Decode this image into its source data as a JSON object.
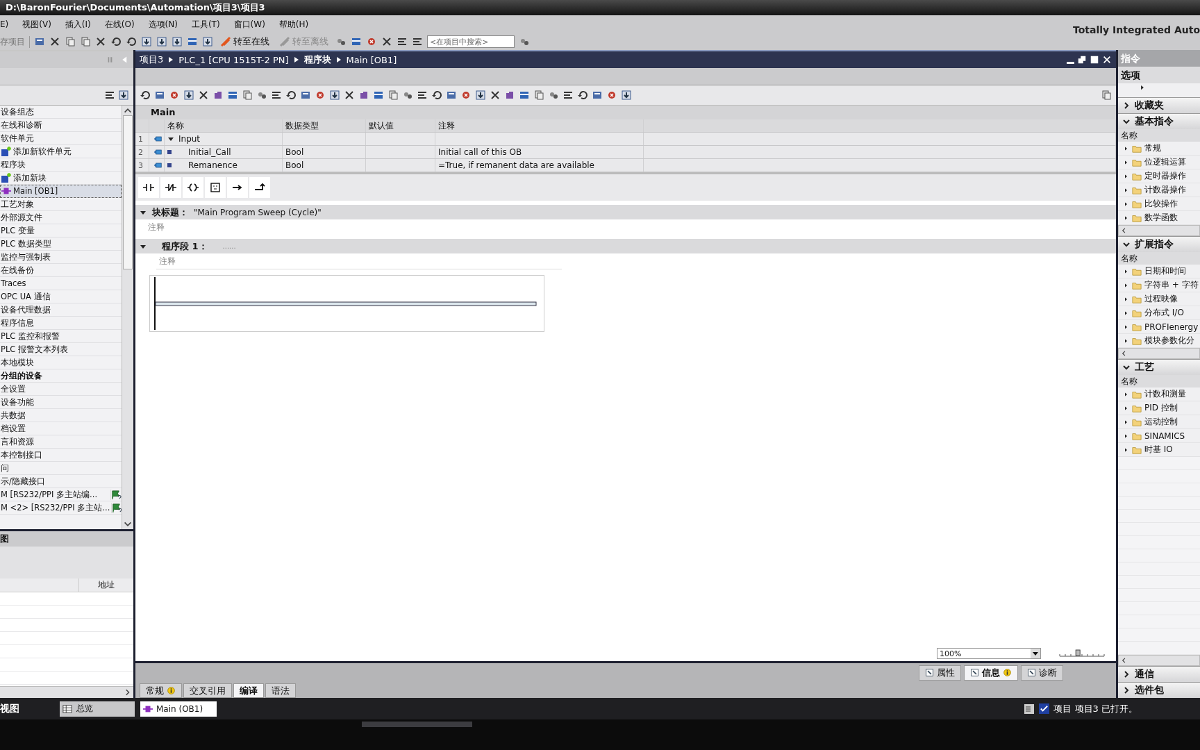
{
  "window": {
    "title": "D:\\BaronFourier\\Documents\\Automation\\项目3\\项目3"
  },
  "menu": [
    "E)",
    "视图(V)",
    "插入(I)",
    "在线(O)",
    "选项(N)",
    "工具(T)",
    "窗口(W)",
    "帮助(H)"
  ],
  "toolbar": {
    "save_label": "存项目",
    "online": {
      "label": "转至在线",
      "disabled": false
    },
    "offline": {
      "label": "转至离线",
      "disabled": true
    },
    "search": {
      "placeholder": "<在项目中搜索>"
    }
  },
  "brand": "Totally Integrated Auto",
  "project_tree": {
    "items": [
      {
        "label": "设备组态",
        "kind": "item",
        "selected": false
      },
      {
        "label": "在线和诊断",
        "kind": "item",
        "selected": false
      },
      {
        "label": "软件单元",
        "kind": "item",
        "selected": false
      },
      {
        "label": "添加新软件单元",
        "kind": "add",
        "selected": false
      },
      {
        "label": "程序块",
        "kind": "item",
        "selected": false
      },
      {
        "label": "添加新块",
        "kind": "add",
        "selected": false
      },
      {
        "label": "Main [OB1]",
        "kind": "block",
        "selected": true
      },
      {
        "label": "工艺对象",
        "kind": "item",
        "selected": false
      },
      {
        "label": "外部源文件",
        "kind": "item",
        "selected": false
      },
      {
        "label": "PLC 变量",
        "kind": "item",
        "selected": false
      },
      {
        "label": "PLC 数据类型",
        "kind": "item",
        "selected": false
      },
      {
        "label": "监控与强制表",
        "kind": "item",
        "selected": false
      },
      {
        "label": "在线备份",
        "kind": "item",
        "selected": false
      },
      {
        "label": "Traces",
        "kind": "item",
        "selected": false
      },
      {
        "label": "OPC UA 通信",
        "kind": "item",
        "selected": false
      },
      {
        "label": "设备代理数据",
        "kind": "item",
        "selected": false
      },
      {
        "label": "程序信息",
        "kind": "item",
        "selected": false
      },
      {
        "label": "PLC 监控和报警",
        "kind": "item",
        "selected": false
      },
      {
        "label": "PLC 报警文本列表",
        "kind": "item",
        "selected": false
      },
      {
        "label": "本地模块",
        "kind": "item",
        "selected": false
      },
      {
        "label": "分组的设备",
        "kind": "group",
        "selected": false
      },
      {
        "label": "全设置",
        "kind": "item",
        "selected": false
      },
      {
        "label": "设备功能",
        "kind": "item",
        "selected": false
      },
      {
        "label": "共数据",
        "kind": "item",
        "selected": false
      },
      {
        "label": "档设置",
        "kind": "item",
        "selected": false
      },
      {
        "label": "言和资源",
        "kind": "item",
        "selected": false
      },
      {
        "label": "本控制接口",
        "kind": "item",
        "selected": false
      },
      {
        "label": "问",
        "kind": "item",
        "selected": false
      },
      {
        "label": "示/隐藏接口",
        "kind": "item",
        "selected": false
      },
      {
        "label": "M [RS232/PPI 多主站编...",
        "kind": "device",
        "selected": false
      },
      {
        "label": "M <2> [RS232/PPI 多主站...",
        "kind": "device",
        "selected": false
      }
    ]
  },
  "detail_view": {
    "title": "图",
    "columns": [
      "地址"
    ]
  },
  "editor": {
    "breadcrumb": [
      "项目3",
      "PLC_1 [CPU 1515T-2 PN]",
      "程序块",
      "Main [OB1]"
    ],
    "interface": {
      "title": "Main",
      "columns": [
        "名称",
        "数据类型",
        "默认值",
        "注释"
      ],
      "rows": [
        {
          "number": "1",
          "kind": "section",
          "expanded": true,
          "name": "Input"
        },
        {
          "number": "2",
          "kind": "param",
          "name": "Initial_Call",
          "type": "Bool",
          "comment": "Initial call of this OB"
        },
        {
          "number": "3",
          "kind": "param",
          "name": "Remanence",
          "type": "Bool",
          "comment": "=True, if remanent data are available"
        }
      ]
    },
    "block_title": {
      "label": "块标题：",
      "value": "\"Main Program Sweep (Cycle)\"",
      "comment": "注释"
    },
    "network": {
      "label": "程序段 1：",
      "title": "......",
      "comment": "注释"
    },
    "zoom": "100%",
    "zoom_slider": {
      "level": 0.4
    }
  },
  "inspector": {
    "tabs": [
      {
        "label": "属性",
        "selected": false,
        "info": false
      },
      {
        "label": "信息",
        "selected": true,
        "info": true
      },
      {
        "label": "诊断",
        "selected": false,
        "info": false
      }
    ],
    "subtabs": [
      {
        "label": "常规",
        "selected": false,
        "info": true
      },
      {
        "label": "交叉引用",
        "selected": false,
        "info": false
      },
      {
        "label": "编译",
        "selected": true,
        "info": false
      },
      {
        "label": "语法",
        "selected": false,
        "info": false
      }
    ]
  },
  "instructions": {
    "title": "指令",
    "options": "选项",
    "sections": [
      {
        "title": "收藏夹",
        "expanded": false
      },
      {
        "title": "基本指令",
        "expanded": true,
        "column": "名称",
        "items": [
          "常规",
          "位逻辑运算",
          "定时器操作",
          "计数器操作",
          "比较操作",
          "数学函数"
        ]
      },
      {
        "title": "扩展指令",
        "expanded": true,
        "column": "名称",
        "items": [
          "日期和时间",
          "字符串 + 字符",
          "过程映像",
          "分布式 I/O",
          "PROFIenergy",
          "模块参数化分"
        ]
      },
      {
        "title": "工艺",
        "expanded": true,
        "column": "名称",
        "items": [
          "计数和测量",
          "PID 控制",
          "运动控制",
          "SINAMICS",
          "时基 IO"
        ]
      },
      {
        "title": "通信",
        "expanded": false
      },
      {
        "title": "选件包",
        "expanded": false
      }
    ]
  },
  "taskbar": {
    "portal": "视图",
    "overview": "总览",
    "tabs": [
      {
        "label": "Main (OB1)",
        "selected": true
      }
    ],
    "status": "项目 项目3 已打开。"
  }
}
